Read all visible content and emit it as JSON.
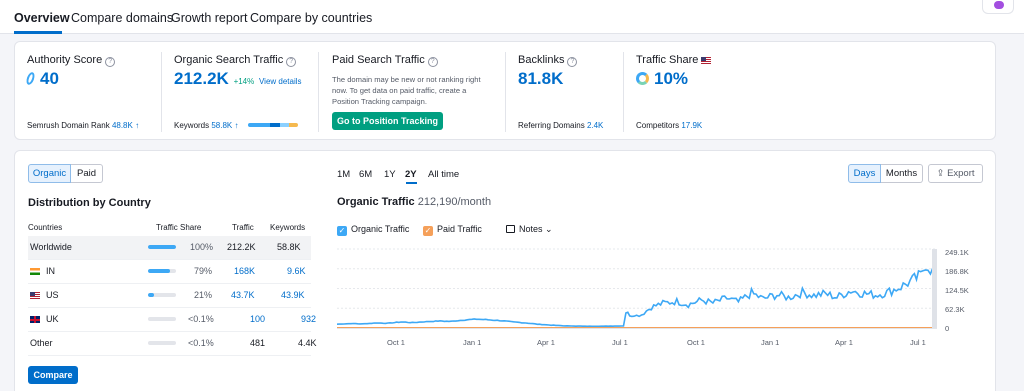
{
  "nav": {
    "tabs": [
      "Overview",
      "Compare domains",
      "Growth report",
      "Compare by countries"
    ]
  },
  "metrics": {
    "authority": {
      "title": "Authority Score",
      "value": "40",
      "foot_label": "Semrush Domain Rank",
      "foot_value": "48.8K"
    },
    "organic": {
      "title": "Organic Search Traffic",
      "value": "212.2K",
      "change": "+14%",
      "link": "View details",
      "foot_label": "Keywords",
      "foot_value": "58.8K"
    },
    "paid": {
      "title": "Paid Search Traffic",
      "note": "The domain may be new or not ranking right now. To get data on paid traffic, create a Position Tracking campaign.",
      "button": "Go to Position Tracking"
    },
    "backlinks": {
      "title": "Backlinks",
      "value": "81.8K",
      "foot_label": "Referring Domains",
      "foot_value": "2.4K"
    },
    "traffic_share": {
      "title": "Traffic Share",
      "value": "10%",
      "foot_label": "Competitors",
      "foot_value": "17.9K"
    }
  },
  "distribution": {
    "toggle": [
      "Organic",
      "Paid"
    ],
    "title": "Distribution by Country",
    "headers": [
      "Countries",
      "Traffic Share",
      "Traffic",
      "Keywords"
    ],
    "rows": [
      {
        "country": "Worldwide",
        "share": "100%",
        "share_frac": 1.0,
        "traffic": "212.2K",
        "keywords": "58.8K"
      },
      {
        "country": "IN",
        "share": "79%",
        "share_frac": 0.79,
        "traffic": "168K",
        "keywords": "9.6K"
      },
      {
        "country": "US",
        "share": "21%",
        "share_frac": 0.21,
        "traffic": "43.7K",
        "keywords": "43.9K"
      },
      {
        "country": "UK",
        "share": "<0.1%",
        "share_frac": 0.0,
        "traffic": "100",
        "keywords": "932"
      },
      {
        "country": "Other",
        "share": "<0.1%",
        "share_frac": 0.0,
        "traffic": "481",
        "keywords": "4.4K"
      }
    ],
    "compare_button": "Compare"
  },
  "chart_controls": {
    "periods": [
      "1M",
      "6M",
      "1Y",
      "2Y",
      "All time"
    ],
    "selected_period": "2Y",
    "granularity": [
      "Days",
      "Months"
    ],
    "export": "Export",
    "title": "Organic Traffic",
    "subtitle": "212,190/month",
    "legend": {
      "organic": "Organic Traffic",
      "paid": "Paid Traffic",
      "notes": "Notes"
    }
  },
  "chart_data": {
    "type": "line",
    "x_tick_labels": [
      "Oct 1",
      "Jan 1",
      "Apr 1",
      "Jul 1",
      "Oct 1",
      "Jan 1",
      "Apr 1",
      "Jul 1"
    ],
    "y_tick_labels": [
      "249.1K",
      "186.8K",
      "124.5K",
      "62.3K",
      "0"
    ],
    "ylim": [
      0,
      249100
    ],
    "series": [
      {
        "name": "Organic Traffic",
        "color": "#3da8f5",
        "x": [
          "2023-07-15",
          "2023-08-01",
          "2023-08-15",
          "2023-09-01",
          "2023-09-15",
          "2023-10-01",
          "2023-10-15",
          "2023-11-01",
          "2023-11-15",
          "2023-12-01",
          "2023-12-15",
          "2024-01-01",
          "2024-01-15",
          "2024-02-01",
          "2024-02-15",
          "2024-03-01",
          "2024-03-15",
          "2024-04-01",
          "2024-04-15",
          "2024-05-01",
          "2024-05-15",
          "2024-06-01",
          "2024-06-15",
          "2024-06-28",
          "2024-07-01",
          "2024-07-08",
          "2024-07-20",
          "2024-08-01",
          "2024-08-15",
          "2024-09-01",
          "2024-09-15",
          "2024-10-01",
          "2024-10-15",
          "2024-11-01",
          "2024-11-15",
          "2024-12-01",
          "2024-12-15",
          "2025-01-01",
          "2025-01-15",
          "2025-02-01",
          "2025-02-15",
          "2025-03-01",
          "2025-03-15",
          "2025-04-01",
          "2025-04-15",
          "2025-05-01",
          "2025-05-15",
          "2025-06-01",
          "2025-06-15",
          "2025-06-25",
          "2025-07-01",
          "2025-07-10",
          "2025-07-15"
        ],
        "values": [
          12000,
          14000,
          13000,
          16000,
          15000,
          19000,
          17000,
          20000,
          22000,
          21000,
          25000,
          28000,
          26000,
          23000,
          19000,
          16000,
          12000,
          9000,
          7000,
          6000,
          5500,
          5500,
          6000,
          6500,
          50000,
          38000,
          42000,
          66000,
          78000,
          84000,
          74000,
          88000,
          79000,
          94000,
          82000,
          110000,
          92000,
          105000,
          96000,
          112000,
          103000,
          108000,
          97000,
          118000,
          110000,
          104000,
          112000,
          130000,
          150000,
          165000,
          205000,
          180000,
          212190
        ]
      },
      {
        "name": "Paid Traffic",
        "color": "#f5a05a",
        "x": [
          "2023-07-15",
          "2025-07-15"
        ],
        "values": [
          0,
          0
        ]
      }
    ]
  }
}
